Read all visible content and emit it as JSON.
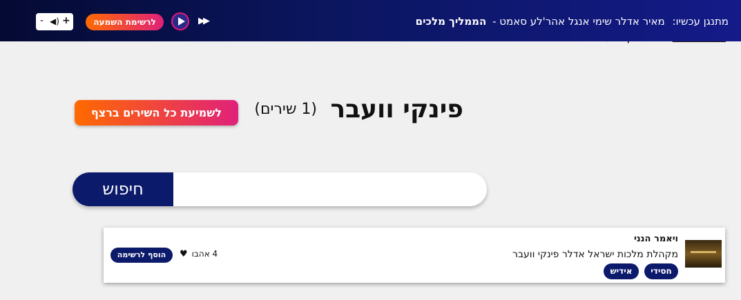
{
  "player": {
    "now_playing_label": "מתנגן עכשיו:",
    "artist": "מאיר אדלר שימי אנגל אהר'לע סאמט -",
    "title": "הממליך מלכים",
    "playlist_button": "לרשימת השמעה",
    "volume_minus": "-",
    "volume_plus": "+",
    "icons": [
      "fast-forward-icon",
      "play-icon",
      "speaker-icon"
    ]
  },
  "breadcrumb": {
    "link": "כל הזמרים",
    "separator": "»",
    "current": "פינקי וועבר"
  },
  "artist_page": {
    "name": "פינקי וועבר",
    "song_count": "(1 שירים)",
    "play_all_button": "לשמיעת כל השירים ברצף"
  },
  "search": {
    "placeholder": "",
    "button": "חיפוש"
  },
  "songs": [
    {
      "title": "ויאמר הנני",
      "subtitle": "מקהלת מלכות ישראל אדלר פינקי וועבר",
      "tags": [
        "חסידי",
        "אידיש"
      ],
      "likes_text": "4 אהבו",
      "add_button": "הוסף לרשימה"
    }
  ],
  "colors": {
    "navy": "#0c1a6b",
    "orange": "#ff6a00",
    "pink": "#e0217a",
    "page_bg": "#f0f0f0"
  }
}
